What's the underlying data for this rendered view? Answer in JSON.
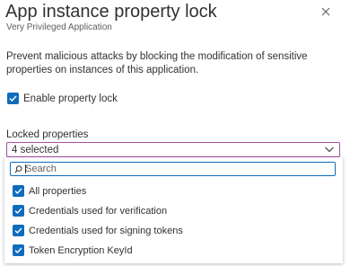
{
  "panel": {
    "title": "App instance property lock",
    "subtitle": "Very Privileged Application",
    "close_icon": "close-icon"
  },
  "description": "Prevent malicious attacks by blocking the modification of sensitive properties on instances of this application.",
  "enable_lock": {
    "label": "Enable property lock",
    "checked": true
  },
  "locked_properties": {
    "label": "Locked properties",
    "selected_text": "4 selected",
    "search_placeholder": "Search",
    "options": [
      {
        "label": "All properties",
        "checked": true
      },
      {
        "label": "Credentials used for verification",
        "checked": true
      },
      {
        "label": "Credentials used for signing tokens",
        "checked": true
      },
      {
        "label": "Token Encryption KeyId",
        "checked": true
      }
    ]
  },
  "colors": {
    "accent": "#0f6cbd",
    "focus_border": "#a74fa0",
    "text": "#323130",
    "secondary_text": "#605e5c"
  }
}
